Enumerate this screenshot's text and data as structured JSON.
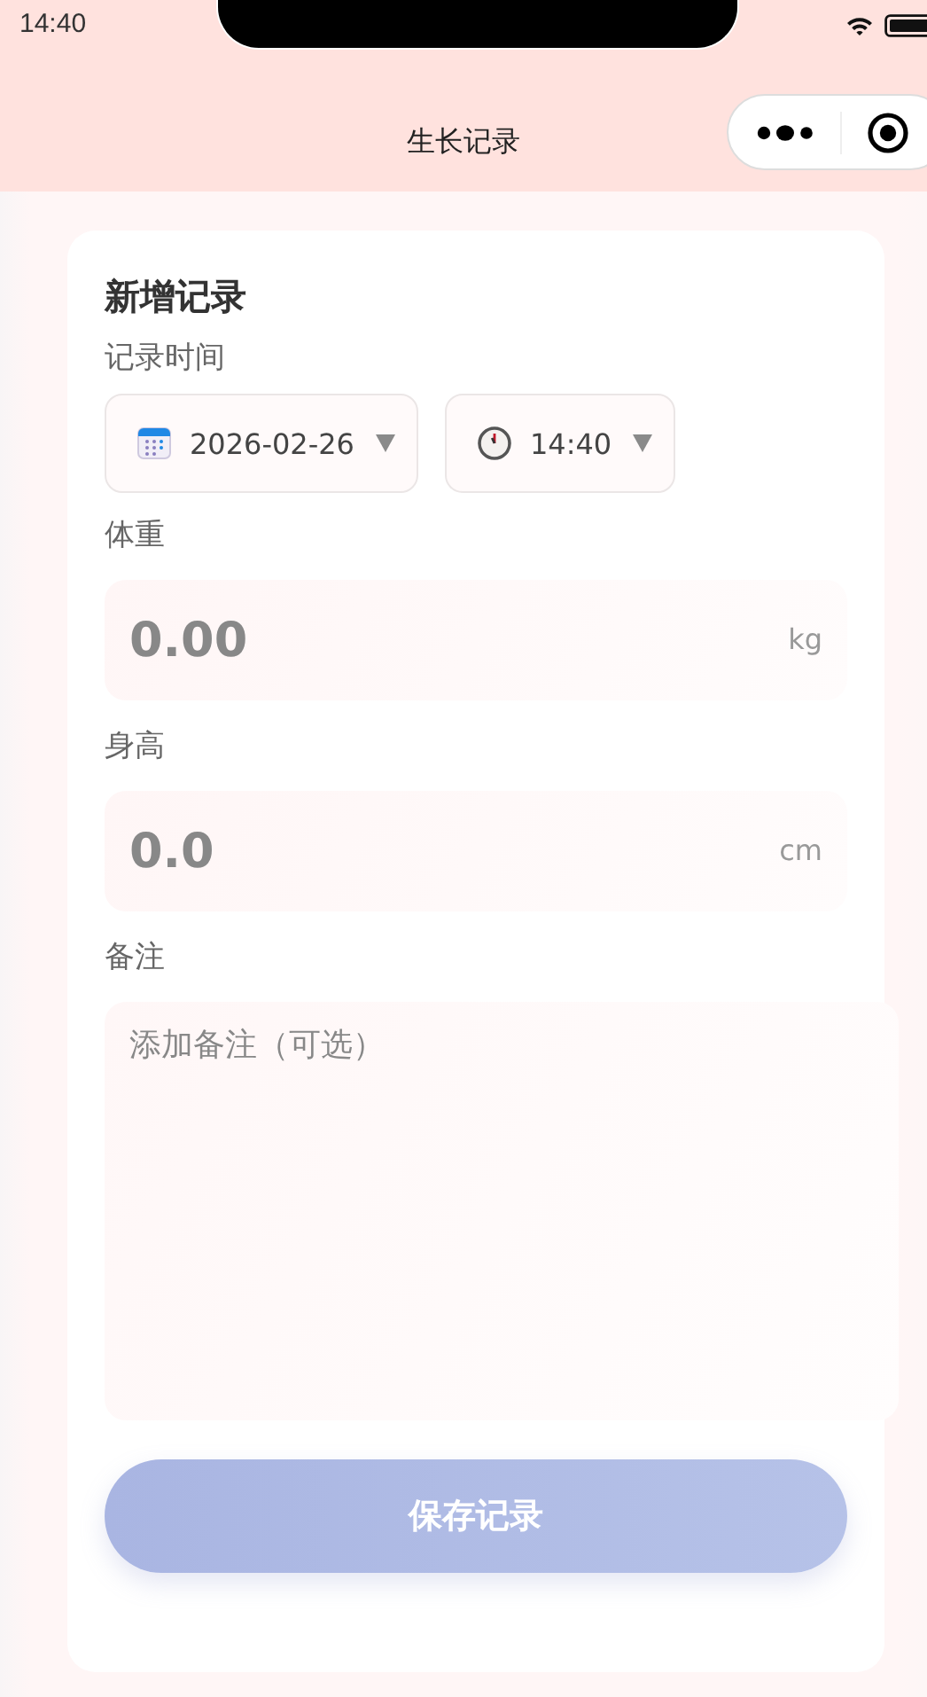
{
  "status_bar": {
    "time": "14:40"
  },
  "nav": {
    "title": "生长记录"
  },
  "form": {
    "title": "新增记录",
    "time_label": "记录时间",
    "date": "2026-02-26",
    "time": "14:40",
    "fields": [
      {
        "label": "体重",
        "placeholder": "0.00",
        "unit": "kg"
      },
      {
        "label": "身高",
        "placeholder": "0.0",
        "unit": "cm"
      }
    ],
    "note": {
      "label": "备注",
      "placeholder": "添加备注（可选）"
    },
    "save_button": {
      "label": "保存记录",
      "disabled": true
    }
  }
}
